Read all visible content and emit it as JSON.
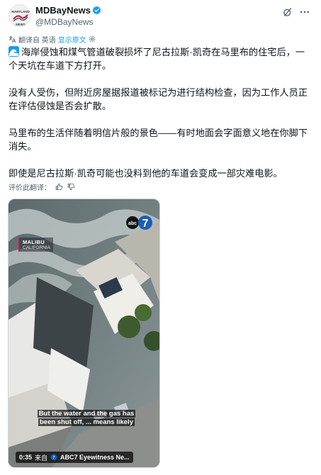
{
  "account": {
    "name": "MDBayNews",
    "handle": "@MDBayNews",
    "avatar_text": "MARYLAND NEWS"
  },
  "header_icons": [
    "grok-icon",
    "more-icon"
  ],
  "translation": {
    "translated_from": "翻译自 英语",
    "show_original": "显示原文"
  },
  "tweet": {
    "paragraphs": [
      "海岸侵蚀和煤气管道破裂损坏了尼古拉斯·凯奇在马里布的住宅后，一个天坑在车道下方打开。",
      "没有人受伤，但附近房屋据报道被标记为进行结构检查，因为工作人员正在评估侵蚀是否会扩散。",
      "马里布的生活伴随着明信片般的景色——有时地面会字面意义地在你脚下消失。",
      "即使是尼古拉斯·凯奇可能也没料到他的车道会变成一部灾难电影。"
    ],
    "emoji": "wave-icon"
  },
  "rate": {
    "label": "评价此翻译："
  },
  "media": {
    "location_line1": "MALIBU",
    "location_line2": "CALIFORNIA",
    "caption_line1": "But the water and the gas has",
    "caption_line2": "been shut off, ... means likely",
    "duration": "0:35",
    "source_prefix": "来自",
    "source_name": "ABC7 Eyewitness Ne...",
    "logo_text": "abc"
  },
  "colors": {
    "accent": "#1d9bf0",
    "verified": "#1d9bf0",
    "muted": "#536471"
  }
}
